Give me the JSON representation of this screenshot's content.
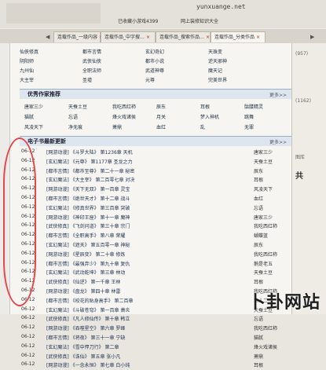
{
  "browser": {
    "url": "yunxuange.net",
    "bookmarks": [
      "已收藏小游戏4399",
      "网上装修知识大全"
    ]
  },
  "tabs": [
    {
      "label": "连载作品_一级内容",
      "close": "×",
      "active": false
    },
    {
      "label": "连载作品_中字搜…",
      "close": "×",
      "active": false
    },
    {
      "label": "连载作品_搜索作品…",
      "close": "×",
      "active": false
    },
    {
      "label": "连载作品_分类作品",
      "close": "×",
      "active": true
    }
  ],
  "top_links": [
    [
      "仙侠修真",
      "都市言情",
      "玄幻奇幻",
      "天珠变"
    ],
    [
      "阴阳师",
      "武侠仙侠",
      "都市小说",
      "逆天邪神"
    ],
    [
      "九州仙",
      "全职法师",
      "武道神尊",
      "魔天记"
    ],
    [
      "大主宰",
      "圣墟",
      "元尊",
      "完美世界"
    ]
  ],
  "author_section": {
    "title": "优秀作家推荐",
    "more": "更多>>",
    "rows": [
      [
        "唐家三少",
        "天蚕土豆",
        "我吃西红柿",
        "辰东",
        "耳根",
        "骷髅精灵"
      ],
      [
        "猫腻",
        "忘语",
        "烽火戏诸侯",
        "月关",
        "梦入神机",
        "跳舞"
      ],
      [
        "风凌天下",
        "净无痕",
        "萧鼎",
        "血红",
        "乱",
        "无罪"
      ]
    ]
  },
  "update_section": {
    "title": "电子书最新更新",
    "more": "更多>>",
    "rows": [
      {
        "date": "06-12",
        "text": "[网游动漫] 《斗罗大陆》 第1236章 天机",
        "author": "唐家三少"
      },
      {
        "date": "06-12",
        "text": "[玄幻魔法] 《元尊》 第1177章 圣龙之力",
        "author": "天蚕土豆"
      },
      {
        "date": "06-12",
        "text": "[都市言情] 《都市至尊》 第二十一章 秘密",
        "author": "辰东"
      },
      {
        "date": "06-12",
        "text": "[玄幻魔法] 《大主宰》 第二百零七章 对决",
        "author": "耳根"
      },
      {
        "date": "06-12",
        "text": "[网游动漫] 《天下无双》 第一百章 灵宝",
        "author": "风凌天下"
      },
      {
        "date": "06-12",
        "text": "[都市言情] 《绝世天才》 第十二章 战斗",
        "author": "血红"
      },
      {
        "date": "06-12",
        "text": "[玄幻魔法] 《修真世界》 第三百章 突破",
        "author": "忘语"
      },
      {
        "date": "06-12",
        "text": "[网游动漫] 《神印王座》 第十一章 魔神",
        "author": "唐家三少"
      },
      {
        "date": "06-12",
        "text": "[武侠修真] 《飞剑问道》 第三十章 宗门",
        "author": "我吃西红柿"
      },
      {
        "date": "06-12",
        "text": "[都市言情] 《全职高手》 第八章 荣耀",
        "author": "蝴蝶蓝"
      },
      {
        "date": "06-12",
        "text": "[玄幻魔法] 《遮天》 第五百零一章 神秘",
        "author": "辰东"
      },
      {
        "date": "06-12",
        "text": "[网游动漫] 《星辰变》 第二十章 修炼",
        "author": "我吃西红柿"
      },
      {
        "date": "06-12",
        "text": "[都市言情] 《最强弃少》 第九十章 复仇",
        "author": "鹅是老五"
      },
      {
        "date": "06-12",
        "text": "[玄幻魔法] 《武动乾坤》 第三章 林动",
        "author": "天蚕土豆"
      },
      {
        "date": "06-12",
        "text": "[武侠修真] 《仙逆》 第一千章 王林",
        "author": "耳根"
      },
      {
        "date": "06-12",
        "text": "[网游动漫] 《盘龙》 第四十章 林雷",
        "author": "我吃西红柿"
      },
      {
        "date": "06-12",
        "text": "[都市言情] 《校花的贴身高手》 第二百章",
        "author": "鱼人二代"
      },
      {
        "date": "06-12",
        "text": "[玄幻魔法] 《斗破苍穹》 第一百章 萧炎",
        "author": "天蚕土豆"
      },
      {
        "date": "06-12",
        "text": "[武侠修真] 《凡人修仙传》 第十章 韩立",
        "author": "忘语"
      },
      {
        "date": "06-12",
        "text": "[网游动漫] 《吞噬星空》 第六章 罗峰",
        "author": "我吃西红柿"
      },
      {
        "date": "06-12",
        "text": "[都市言情] 《将夜》 第三十一章 宁缺",
        "author": "猫腻"
      },
      {
        "date": "06-12",
        "text": "[玄幻魔法] 《雪中悍刀行》 第二章",
        "author": "烽火戏诸侯"
      },
      {
        "date": "06-12",
        "text": "[武侠修真] 《诛仙》 第五章 张小凡",
        "author": "萧鼎"
      },
      {
        "date": "06-12",
        "text": "[网游动漫] 《一念永恒》 第七章 白小纯",
        "author": "耳根"
      }
    ]
  },
  "right_sidebar": {
    "items": [
      "(957)",
      "(1162)",
      "图库",
      "共"
    ]
  },
  "watermark": "卜卦网站"
}
